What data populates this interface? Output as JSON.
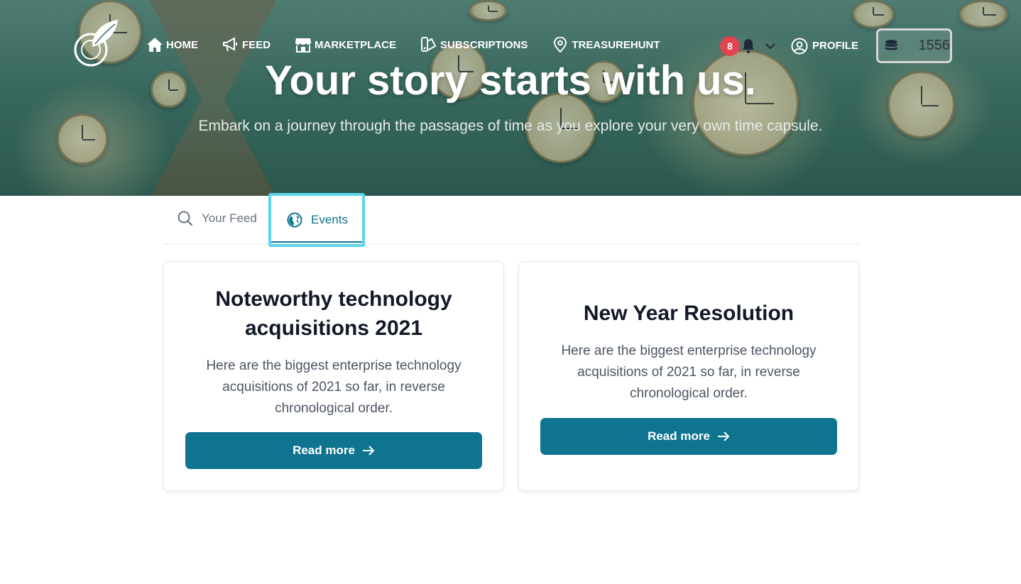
{
  "nav": {
    "items": [
      {
        "label": "HOME",
        "icon": "home-icon"
      },
      {
        "label": "FEED",
        "icon": "megaphone-icon"
      },
      {
        "label": "MARKETPLACE",
        "icon": "store-icon"
      },
      {
        "label": "SUBSCRIPTIONS",
        "icon": "swatch-icon"
      },
      {
        "label": "TREASUREHUNT",
        "icon": "map-pin-icon"
      }
    ],
    "notifications_count": "8",
    "profile_label": "PROFILE",
    "coins": "1556"
  },
  "hero": {
    "title": "Your story starts with us.",
    "subtitle": "Embark on a journey through the passages of time as you explore your very own time capsule."
  },
  "tabs": [
    {
      "label": "Your Feed",
      "icon": "search-icon",
      "active": false
    },
    {
      "label": "Events",
      "icon": "globe-icon",
      "active": true
    }
  ],
  "cards": [
    {
      "title": "Noteworthy technology acquisitions 2021",
      "text": "Here are the biggest enterprise technology acquisitions of 2021 so far, in reverse chronological order.",
      "button": "Read more"
    },
    {
      "title": "New Year Resolution",
      "text": "Here are the biggest enterprise technology acquisitions of 2021 so far, in reverse chronological order.",
      "button": "Read more"
    }
  ],
  "colors": {
    "accent": "#0e7490",
    "badge": "#e0454f",
    "focus_ring": "#5ad6ea"
  }
}
